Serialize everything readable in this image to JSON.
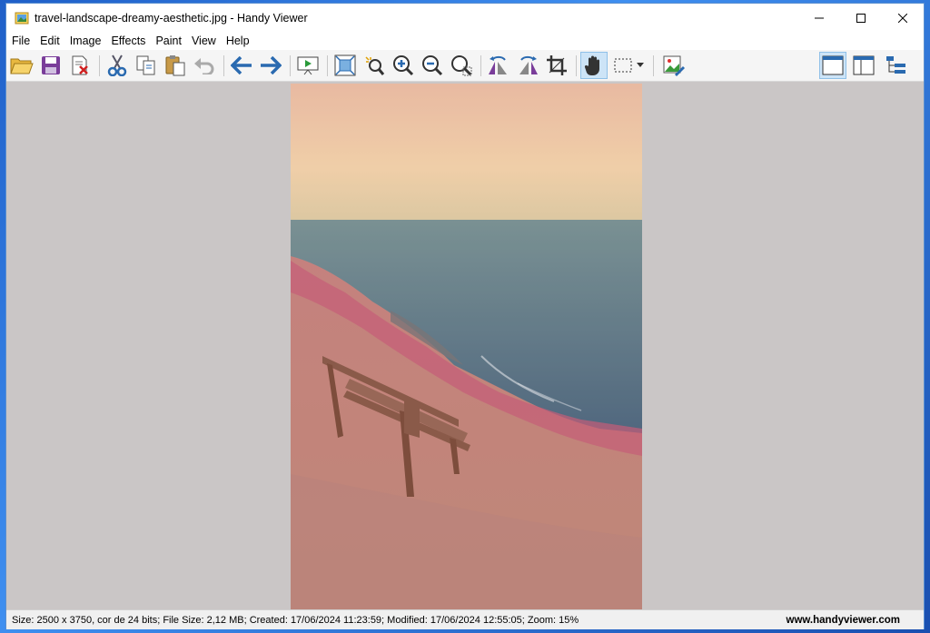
{
  "window": {
    "title": "travel-landscape-dreamy-aesthetic.jpg - Handy Viewer"
  },
  "menu": [
    "File",
    "Edit",
    "Image",
    "Effects",
    "Paint",
    "View",
    "Help"
  ],
  "toolbar": {
    "buttons": [
      "open-folder-icon",
      "save-icon",
      "delete-file-icon",
      "cut-icon",
      "copy-icon",
      "paste-icon",
      "undo-icon",
      "previous-arrow-icon",
      "next-arrow-icon",
      "slideshow-icon",
      "fit-to-window-icon",
      "zoom-selection-icon",
      "zoom-in-icon",
      "zoom-out-icon",
      "zoom-reset-icon",
      "rotate-left-icon",
      "rotate-right-icon",
      "crop-icon",
      "hand-tool-icon",
      "rect-select-icon",
      "edit-image-icon",
      "single-view-icon",
      "browser-view-icon",
      "tree-view-icon"
    ],
    "active_tool": "hand-tool-icon"
  },
  "status": {
    "info": "Size: 2500 x 3750, cor de 24 bits; File Size: 2,12 MB; Created: 17/06/2024 11:23:59; Modified: 17/06/2024 12:55:05; Zoom: 15%",
    "website": "www.handyviewer.com"
  },
  "colors": {
    "viewport_bg": "#cac6c6",
    "accent": "#2b6ab3",
    "window_bg": "#f0f0f0"
  }
}
